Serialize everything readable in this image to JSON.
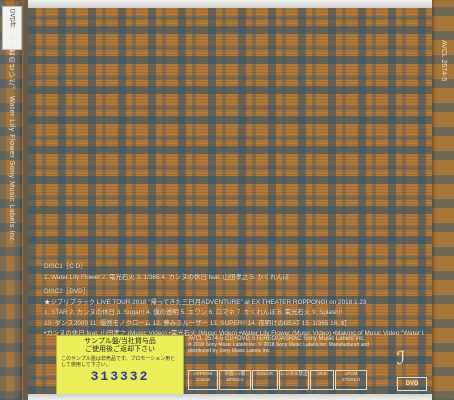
{
  "spine": {
    "sticker": "DVD付",
    "text": "ぜんぶ君のせいだ。 Water Lily Flower Sony Music Labels Inc."
  },
  "right_spine_text": "AVCL 2574-5",
  "tracklist": {
    "disc1_heading": "DISC1［C D］",
    "disc1_tracks": "1. Water Lily Flower  2. 電光石火  3. 1/365  4. カンヌの休日 feat. 山田孝之  5. かくれんぼ",
    "disc2_heading": "DISC2［DVD］",
    "disc2_live": "★ジブリブラック LIVE TOUR 2018 \"帰ってきた三日月ADVENTURE\" at EX THEATER ROPPONGI on 2018.1.23",
    "disc2_row1": "1. STAR  2. カンヌの休日  3. Sugar!!  4. 僕の透明  5. エワン  6. ロマネ  7. かくれんぼ  8. 電光石火  9. Splash!!",
    "disc2_row2": "10. ダンス2000  11. 優然モノクローム  12. 夢みるルーザー  13. SUPER!!  14. 夜明けのBEAT  15. 1/365  16. 虹",
    "disc2_row3": "•カンヌの休日 feat. 山田孝之 (Music Video)  •電光石火 (Music Video)  •Water Lily Flower (Music Video)  •Making of Music Video \"Water Lily Flower\""
  },
  "sticker": {
    "title": "サンプル盤/当社貸与品",
    "title2": "ご使用後ご返却下さい",
    "note": "このサンプル盤は非売品です。プロモーション用として使用して下さい。",
    "code": "313332"
  },
  "info": {
    "catalog": "AVCL 2574-5  CD+DVD    STEREO/JASRAC    Sony Music Labels Inc.",
    "legal": "℗ 2018 Sony Music Labels Inc. © 2018 Sony Music Labels Inc. Manufactured and distributed by Sony Music Labels Inc."
  },
  "specs": {
    "box1": "APPROX 103min",
    "box2": "片面・2層 MPEG-2",
    "box3": "COLOR",
    "box4": "レンタル禁止",
    "box5": "16:9",
    "box6": "LPCM STEREO"
  },
  "logos": {
    "label": "ℐ",
    "dvd": "DVD"
  }
}
